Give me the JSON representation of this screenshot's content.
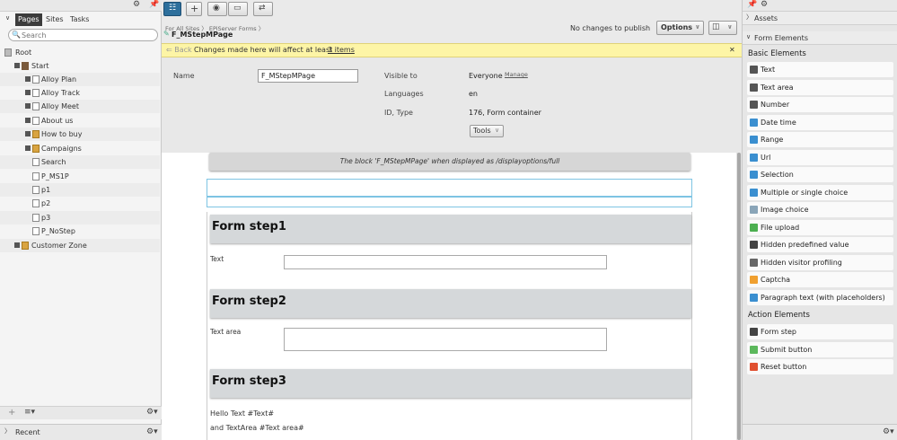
{
  "left": {
    "tabs": [
      "Pages",
      "Sites",
      "Tasks"
    ],
    "search_placeholder": "Search",
    "tree": [
      {
        "label": "Root",
        "icon": "root"
      },
      {
        "label": "Start",
        "icon": "home"
      },
      {
        "label": "Alloy Plan",
        "icon": "page"
      },
      {
        "label": "Alloy Track",
        "icon": "page"
      },
      {
        "label": "Alloy Meet",
        "icon": "page"
      },
      {
        "label": "About us",
        "icon": "page"
      },
      {
        "label": "How to buy",
        "icon": "folder"
      },
      {
        "label": "Campaigns",
        "icon": "folder"
      },
      {
        "label": "Search",
        "icon": "page"
      },
      {
        "label": "P_MS1P",
        "icon": "page"
      },
      {
        "label": "p1",
        "icon": "page"
      },
      {
        "label": "p2",
        "icon": "page"
      },
      {
        "label": "p3",
        "icon": "page"
      },
      {
        "label": "P_NoStep",
        "icon": "page"
      },
      {
        "label": "Customer Zone",
        "icon": "folder"
      }
    ],
    "recent_label": "Recent"
  },
  "center": {
    "breadcrumb": "For All Sites 〉 EPiServer Forms 〉",
    "page_name": "F_MStepMPage",
    "no_changes": "No changes to publish",
    "options_label": "Options",
    "banner": {
      "back": "Back",
      "message": "Changes made here will affect at least",
      "link": "3 items",
      "close": "✕"
    },
    "props": {
      "name_label": "Name",
      "name_value": "F_MStepMPage",
      "visible_label": "Visible to",
      "visible_value": "Everyone",
      "manage_label": "Manage",
      "languages_label": "Languages",
      "languages_value": "en",
      "idtype_label": "ID, Type",
      "idtype_value": "176, Form container",
      "tools_label": "Tools"
    },
    "display_message": "The block 'F_MStepMPage' when displayed as /displayoptions/full",
    "form": {
      "steps": [
        "Form step1",
        "Form step2",
        "Form step3"
      ],
      "text_label": "Text",
      "textarea_label": "Text area",
      "summary_line1": "Hello Text #Text#",
      "summary_line2": "and  TextArea #Text area#"
    }
  },
  "right": {
    "assets_label": "Assets",
    "form_elements_label": "Form Elements",
    "basic_label": "Basic Elements",
    "basic_items": [
      {
        "label": "Text",
        "color": "#555555"
      },
      {
        "label": "Text area",
        "color": "#555555"
      },
      {
        "label": "Number",
        "color": "#555555"
      },
      {
        "label": "Date time",
        "color": "#3a8fd0"
      },
      {
        "label": "Range",
        "color": "#3a8fd0"
      },
      {
        "label": "Url",
        "color": "#3a8fd0"
      },
      {
        "label": "Selection",
        "color": "#3a8fd0"
      },
      {
        "label": "Multiple or single choice",
        "color": "#3a8fd0"
      },
      {
        "label": "Image choice",
        "color": "#8aa5b8"
      },
      {
        "label": "File upload",
        "color": "#4caf50"
      },
      {
        "label": "Hidden predefined value",
        "color": "#444444"
      },
      {
        "label": "Hidden visitor profiling",
        "color": "#666666"
      },
      {
        "label": "Captcha",
        "color": "#f0a030"
      },
      {
        "label": "Paragraph text (with placeholders)",
        "color": "#3a8fd0"
      }
    ],
    "action_label": "Action Elements",
    "action_items": [
      {
        "label": "Form step",
        "color": "#444444"
      },
      {
        "label": "Submit button",
        "color": "#5cb85c"
      },
      {
        "label": "Reset button",
        "color": "#e05030"
      }
    ]
  }
}
